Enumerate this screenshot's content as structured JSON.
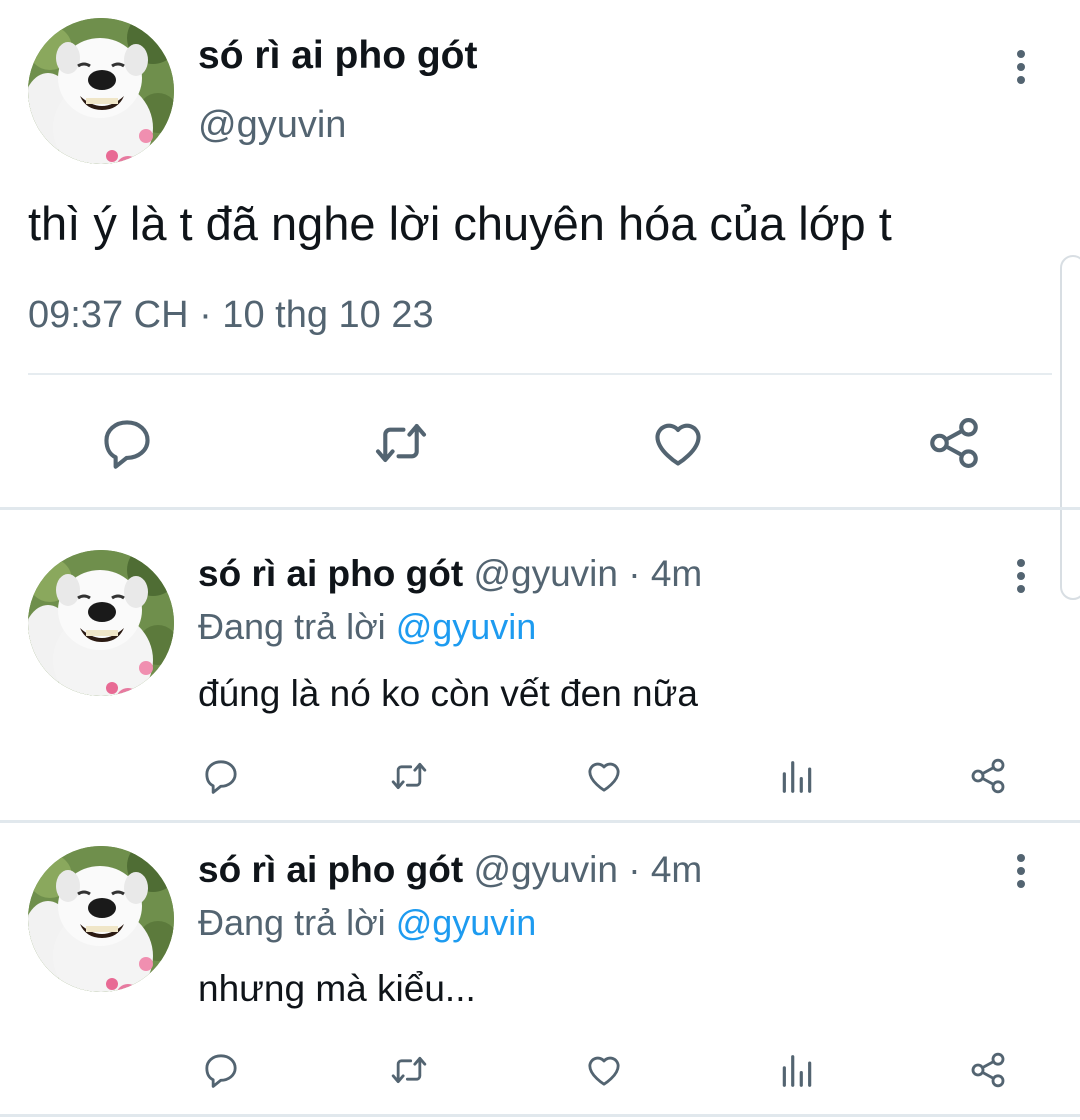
{
  "main_tweet": {
    "display_name": "só rì ai pho gót",
    "handle": "@gyuvin",
    "text": "thì ý là t đã nghe lời chuyên hóa của lớp t",
    "timestamp": "09:37 CH · 10 thg 10 23",
    "avatar_icon": "dog-avatar",
    "actions": [
      "reply-icon",
      "retweet-icon",
      "like-icon",
      "share-icon"
    ]
  },
  "replies": [
    {
      "display_name": "só rì ai pho gót",
      "handle_time": "@gyuvin · 4m",
      "replying_prefix": "Đang trả lời",
      "replying_to": "@gyuvin",
      "text": "đúng là nó ko còn vết đen nữa",
      "actions": [
        "reply-icon",
        "retweet-icon",
        "like-icon",
        "analytics-icon",
        "share-icon"
      ]
    },
    {
      "display_name": "só rì ai pho gót",
      "handle_time": "@gyuvin · 4m",
      "replying_prefix": "Đang trả lời",
      "replying_to": "@gyuvin",
      "text": "nhưng mà kiểu...",
      "actions": [
        "reply-icon",
        "retweet-icon",
        "like-icon",
        "analytics-icon",
        "share-icon"
      ]
    }
  ],
  "colors": {
    "primary_text": "#0f1419",
    "secondary_text": "#536471",
    "mention": "#1d9bf0",
    "divider": "#e6ecf0"
  }
}
